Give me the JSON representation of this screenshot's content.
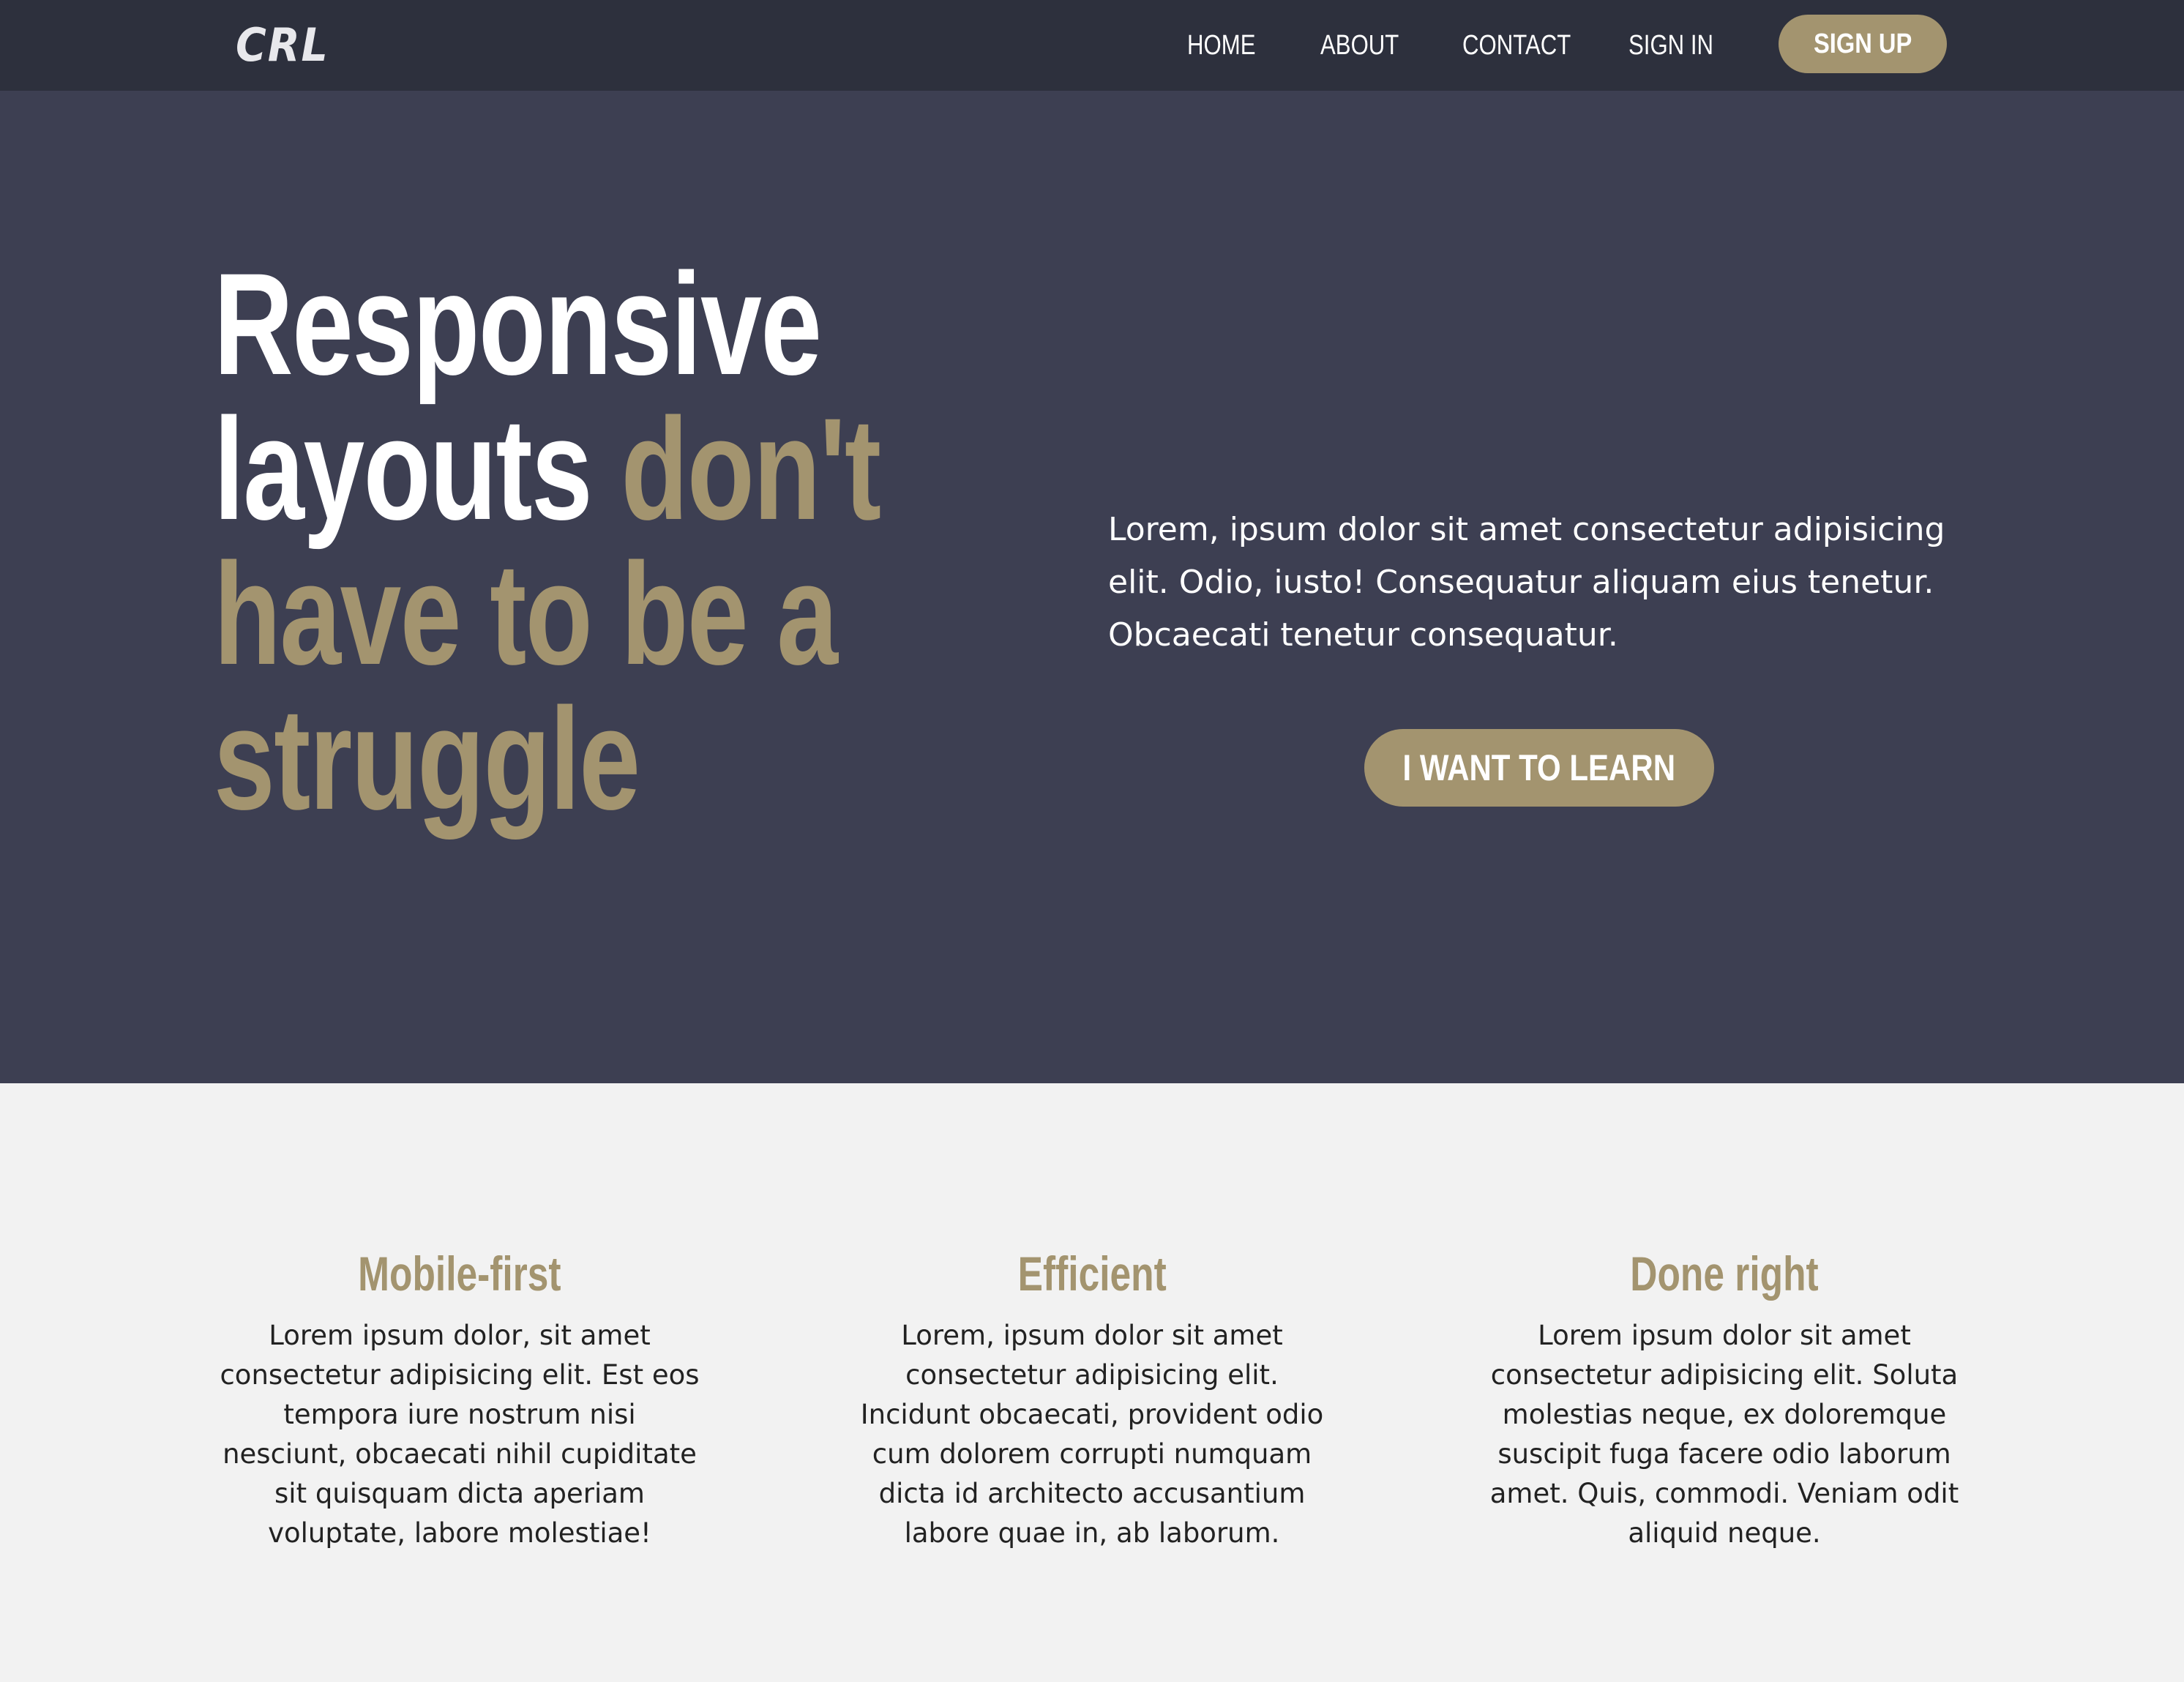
{
  "nav": {
    "logo": "CRL",
    "links": [
      "HOME",
      "ABOUT",
      "CONTACT",
      "SIGN IN"
    ],
    "signup_label": "SIGN UP"
  },
  "hero": {
    "title_white_1": "Responsive",
    "title_white_2": "layouts",
    "title_accent_2": "don't",
    "title_accent_3": "have to be a",
    "title_accent_4": "struggle",
    "description": "Lorem, ipsum dolor sit amet consectetur adipisicing elit. Odio, iusto! Consequatur aliquam eius tenetur. Obcaecati tenetur consequatur.",
    "cta_label": "I WANT TO LEARN"
  },
  "features": [
    {
      "title": "Mobile-first",
      "text": "Lorem ipsum dolor, sit amet consectetur adipisicing elit. Est eos tempora iure nostrum nisi nesciunt, obcaecati nihil cupiditate sit quisquam dicta aperiam voluptate, labore molestiae!"
    },
    {
      "title": "Efficient",
      "text": "Lorem, ipsum dolor sit amet consectetur adipisicing elit. Incidunt obcaecati, provident odio cum dolorem corrupti numquam dicta id architecto accusantium labore quae in, ab laborum."
    },
    {
      "title": "Done right",
      "text": "Lorem ipsum dolor sit amet consectetur adipisicing elit. Soluta molestias neque, ex doloremque suscipit fuga facere odio laborum amet. Quis, commodi. Veniam odit aliquid neque."
    }
  ],
  "colors": {
    "navbar_bg": "#2d303d",
    "hero_bg": "#3d3f52",
    "accent": "#a3946f",
    "section_bg": "#f2f2f2"
  }
}
